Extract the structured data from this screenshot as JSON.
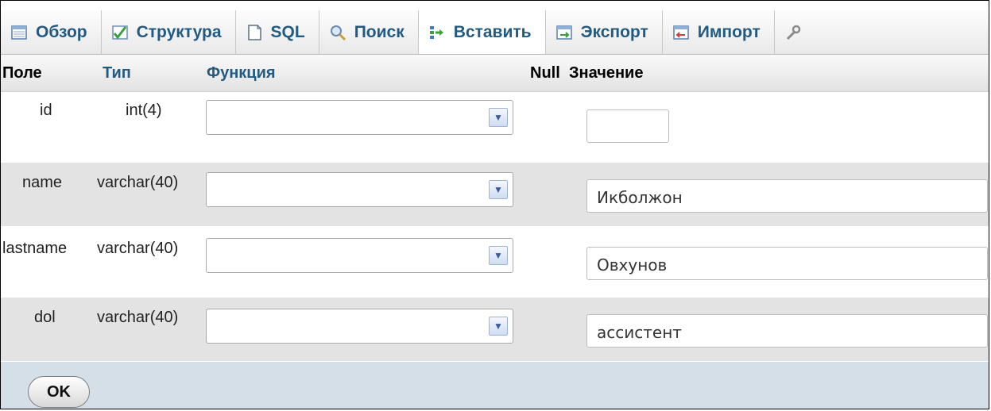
{
  "tabs": [
    {
      "label": "Обзор",
      "icon": "browse-icon"
    },
    {
      "label": "Структура",
      "icon": "structure-icon"
    },
    {
      "label": "SQL",
      "icon": "sql-icon"
    },
    {
      "label": "Поиск",
      "icon": "search-icon"
    },
    {
      "label": "Вставить",
      "icon": "insert-icon",
      "active": true
    },
    {
      "label": "Экспорт",
      "icon": "export-icon"
    },
    {
      "label": "Импорт",
      "icon": "import-icon"
    },
    {
      "label": "",
      "icon": "operations-icon"
    }
  ],
  "header": {
    "field": "Поле",
    "type": "Тип",
    "function": "Функция",
    "null": "Null",
    "value": "Значение"
  },
  "rows": [
    {
      "field": "id",
      "type": "int(4)",
      "value": ""
    },
    {
      "field": "name",
      "type": "varchar(40)",
      "value": "Икболжон"
    },
    {
      "field": "lastname",
      "type": "varchar(40)",
      "value": "Овхунов"
    },
    {
      "field": "dol",
      "type": "varchar(40)",
      "value": "ассистент"
    }
  ],
  "footer": {
    "ok_label": "OK"
  },
  "colors": {
    "link": "#235a81",
    "footer_bg": "#d5dfe8",
    "row_alt": "#e3e3e3"
  }
}
